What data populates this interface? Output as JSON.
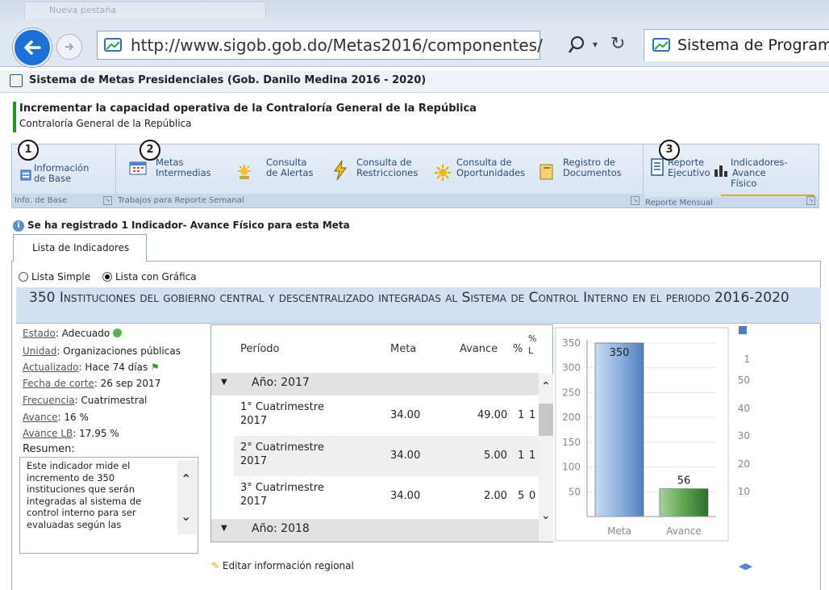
{
  "browser": {
    "tab_inactive": "Nueva pestaña",
    "address": "http://www.sigob.gob.do/Metas2016/componentes/",
    "active_tab": "Sistema de Programac"
  },
  "app": {
    "title": "Sistema de Metas Presidenciales (Gob. Danilo Medina 2016 - 2020)"
  },
  "goal": {
    "title": "Incrementar la capacidad operativa de la Contraloría General de la República",
    "subtitle": "Contraloría General de la República"
  },
  "ribbon": {
    "groups": [
      {
        "num": "1",
        "label": "Info. de Base"
      },
      {
        "num": "2",
        "label": "Trabajos para Reporte Semanal"
      },
      {
        "num": "3",
        "label": "Reporte Mensual"
      }
    ],
    "buttons": {
      "info_base": [
        "Información",
        "de Base"
      ],
      "metas": [
        "Metas",
        "Intermedias"
      ],
      "alertas": [
        "Consulta",
        "de Alertas"
      ],
      "restricciones": [
        "Consulta de",
        "Restricciones"
      ],
      "oportunidades": [
        "Consulta de",
        "Oportunidades"
      ],
      "documentos": [
        "Registro de",
        "Documentos"
      ],
      "reporte": [
        "Reporte",
        "Ejecutivo"
      ],
      "indicadores": [
        "Indicadores-",
        "Avance",
        "Físico"
      ]
    }
  },
  "info_message": "Se ha registrado 1 Indicador- Avance Físico para esta Meta",
  "tab_label": "Lista de Indicadores",
  "view_options": {
    "simple": "Lista Simple",
    "grafica": "Lista con Gráfica",
    "selected": "grafica"
  },
  "indicator": {
    "title": "350 Instituciones del gobierno central y descentralizado integradas al Sistema de Control Interno en el periodo 2016-2020",
    "estado_label": "Estado",
    "estado": "Adecuado",
    "unidad_label": "Unidad",
    "unidad": "Organizaciones públicas",
    "actualizado_label": "Actualizado",
    "actualizado": "Hace 74 días",
    "fecha_label": "Fecha de corte",
    "fecha": "26 sep 2017",
    "frecuencia_label": "Frecuencia",
    "frecuencia": "Cuatrimestral",
    "avance_label": "Avance",
    "avance": "16 %",
    "avance_lb_label": "Avance LB",
    "avance_lb": "17.95 %",
    "resumen_label": "Resumen:",
    "resumen": "Este indicador mide el incremento de 350 instituciones que serán integradas al sistema de control interno para ser evaluadas según las"
  },
  "table": {
    "headers": [
      "Período",
      "Meta",
      "Avance",
      "%",
      "%",
      "L"
    ],
    "groups": [
      "Año: 2017",
      "Año: 2018"
    ],
    "rows": [
      {
        "periodo": [
          "1° Cuatrimestre",
          "2017"
        ],
        "meta": "34.00",
        "avance": "49.00",
        "c1": "1",
        "c2": "1"
      },
      {
        "periodo": [
          "2° Cuatrimestre",
          "2017"
        ],
        "meta": "34.00",
        "avance": "5.00",
        "c1": "1",
        "c2": "1"
      },
      {
        "periodo": [
          "3° Cuatrimestre",
          "2017"
        ],
        "meta": "34.00",
        "avance": "2.00",
        "c1": "5",
        "c2": "0"
      }
    ]
  },
  "chart_data": {
    "type": "bar",
    "categories": [
      "Meta",
      "Avance"
    ],
    "values": [
      350,
      56
    ],
    "ylim": [
      0,
      350
    ],
    "yticks": [
      50,
      100,
      150,
      200,
      250,
      300,
      350
    ],
    "colors": [
      "#9bbde6",
      "#3f8a3a"
    ]
  },
  "right_axis_ticks": [
    "1",
    "50",
    "40",
    "30",
    "20",
    "10"
  ],
  "edit_link": "Editar información regional"
}
